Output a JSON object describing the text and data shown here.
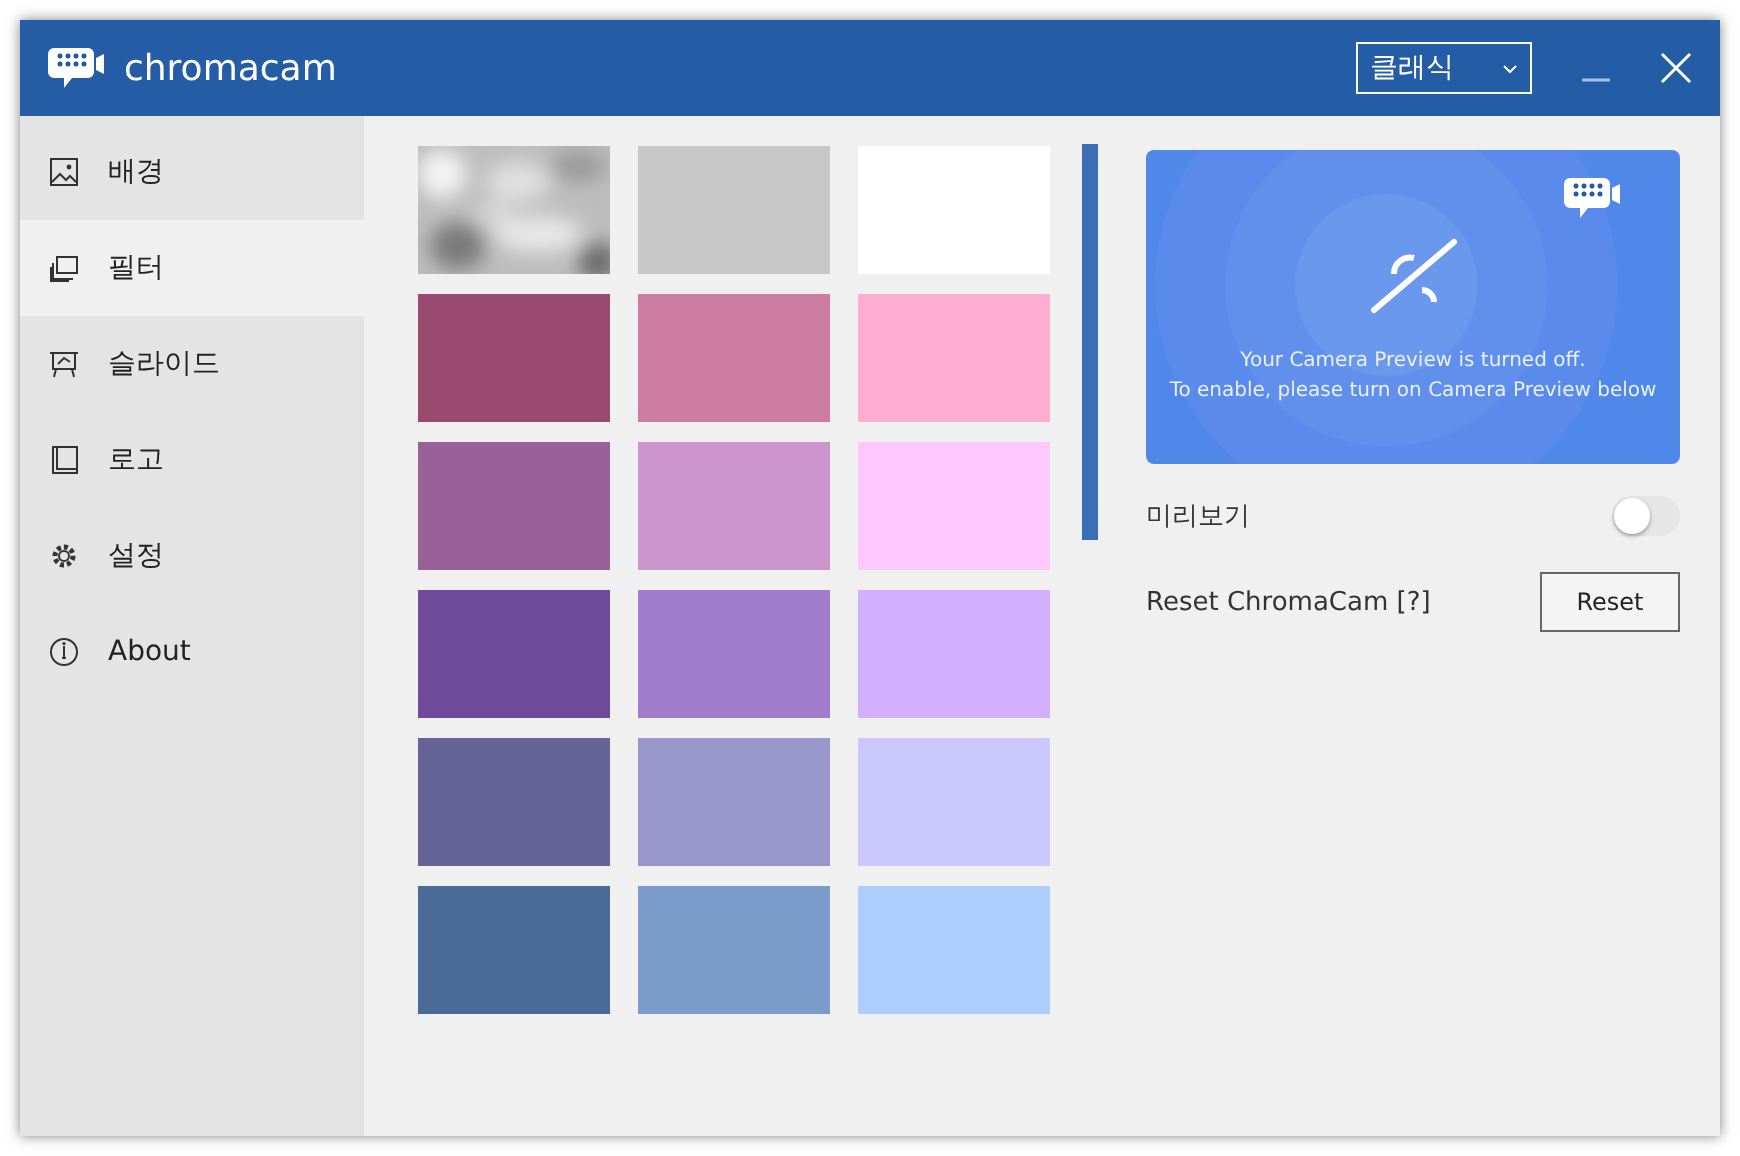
{
  "window": {
    "title": "chromacam"
  },
  "mode_dropdown": {
    "value": "클래식"
  },
  "sidebar": {
    "items": [
      {
        "label": "배경",
        "selected": false
      },
      {
        "label": "필터",
        "selected": true
      },
      {
        "label": "슬라이드",
        "selected": false
      },
      {
        "label": "로고",
        "selected": false
      },
      {
        "label": "설정",
        "selected": false
      },
      {
        "label": "About",
        "selected": false
      }
    ]
  },
  "swatches": [
    {
      "kind": "picture"
    },
    {
      "kind": "color",
      "color": "#c8c8c8"
    },
    {
      "kind": "color",
      "color": "#ffffff"
    },
    {
      "kind": "color",
      "color": "#9a4a6e"
    },
    {
      "kind": "color",
      "color": "#cb7c9f"
    },
    {
      "kind": "color",
      "color": "#ffaed0"
    },
    {
      "kind": "color",
      "color": "#9a6198"
    },
    {
      "kind": "color",
      "color": "#cc96cc"
    },
    {
      "kind": "color",
      "color": "#ffc8ff"
    },
    {
      "kind": "color",
      "color": "#6f4a98"
    },
    {
      "kind": "color",
      "color": "#a07ccb"
    },
    {
      "kind": "color",
      "color": "#d4aeff"
    },
    {
      "kind": "color",
      "color": "#666398"
    },
    {
      "kind": "color",
      "color": "#9896cb"
    },
    {
      "kind": "color",
      "color": "#cbc8ff"
    },
    {
      "kind": "color",
      "color": "#4a6a98"
    },
    {
      "kind": "color",
      "color": "#7b9ccb"
    },
    {
      "kind": "color",
      "color": "#adcfff"
    }
  ],
  "preview": {
    "message_lines": [
      "Your Camera Preview is turned off.",
      "To enable, please turn on Camera Preview below"
    ]
  },
  "preview_toggle": {
    "label": "미리보기",
    "on": false
  },
  "reset": {
    "label": "Reset ChromaCam [?]",
    "button": "Reset"
  }
}
